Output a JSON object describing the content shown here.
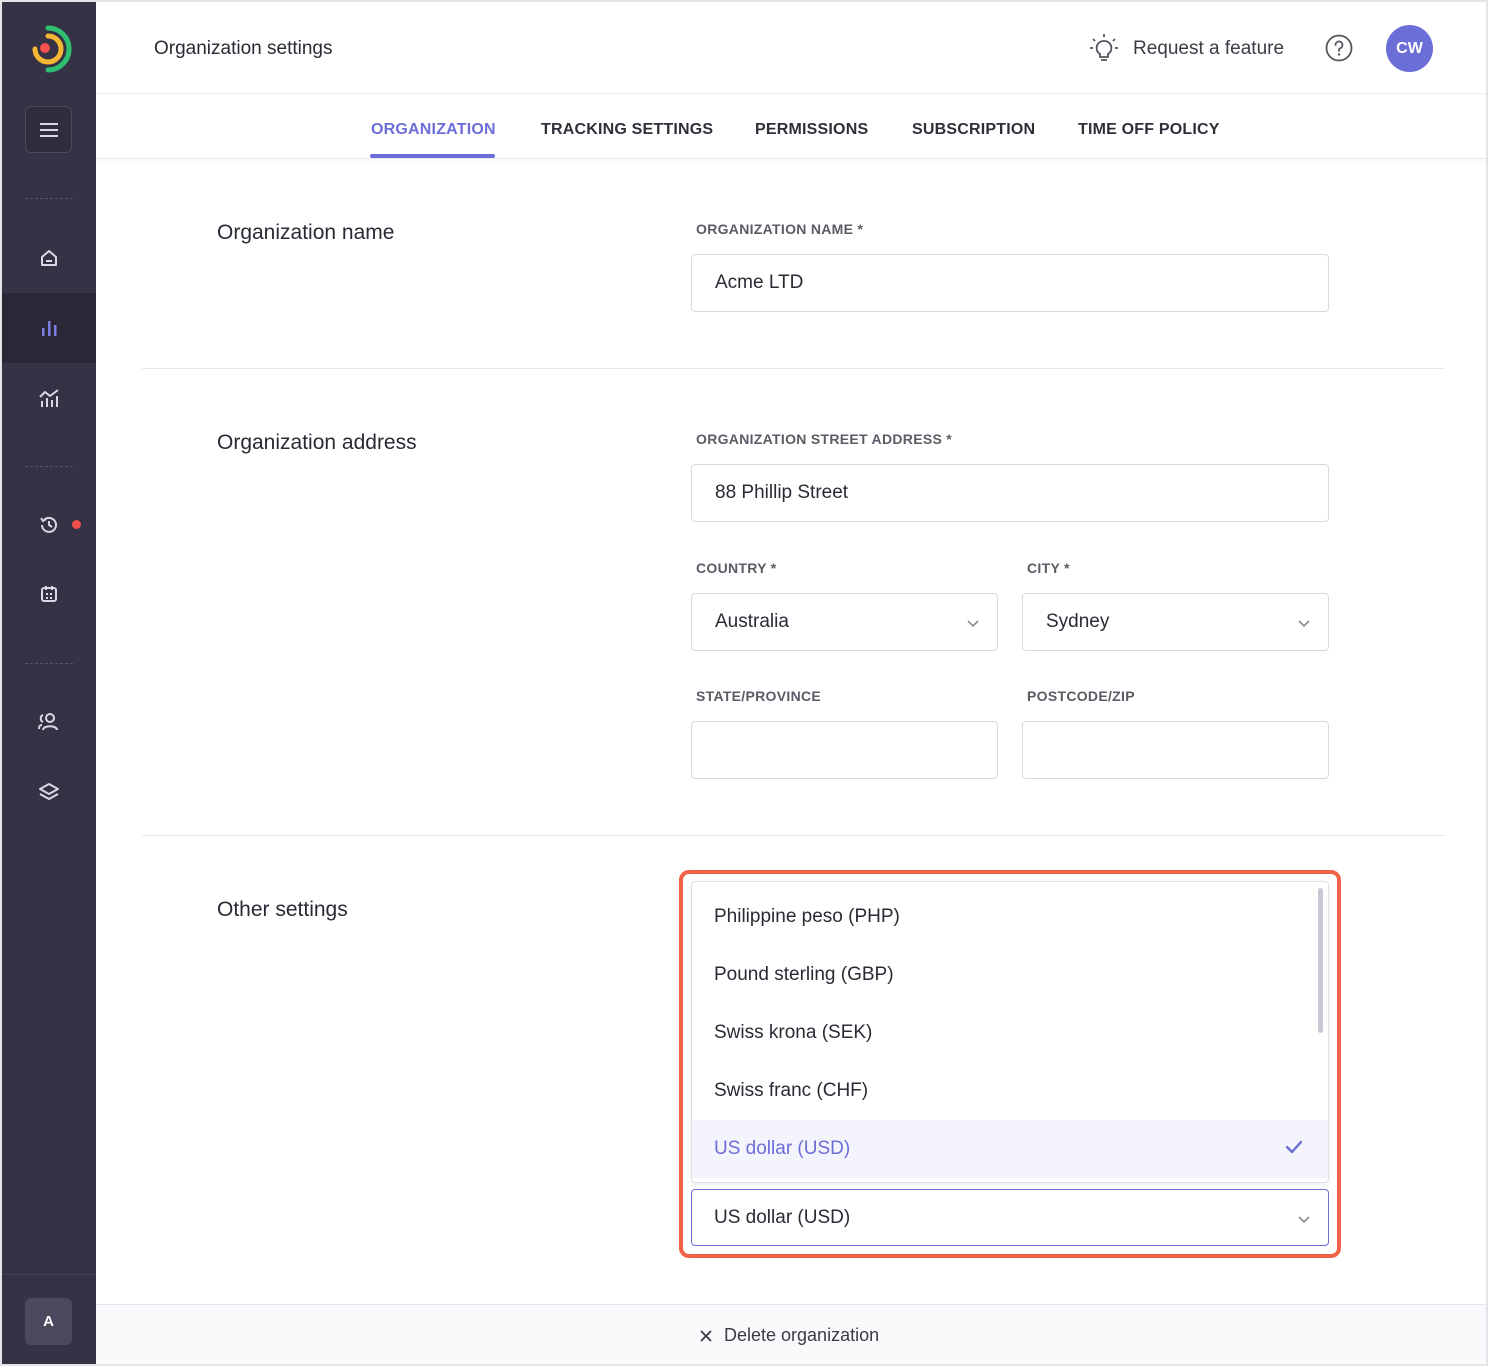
{
  "header": {
    "title": "Organization settings",
    "request_feature": "Request a feature",
    "avatar_initials": "CW"
  },
  "tabs": [
    {
      "label": "ORGANIZATION",
      "active": true
    },
    {
      "label": "TRACKING SETTINGS"
    },
    {
      "label": "PERMISSIONS"
    },
    {
      "label": "SUBSCRIPTION"
    },
    {
      "label": "TIME OFF POLICY"
    }
  ],
  "sidebar": {
    "items": [
      "menu-icon",
      "home-icon",
      "bar-chart-icon",
      "trend-chart-icon",
      "history-icon",
      "calendar-icon",
      "users-icon",
      "layers-icon"
    ],
    "active_item": "bar-chart-icon",
    "account_initial": "A",
    "notification_color": "#f2504b"
  },
  "sections": {
    "org_name": {
      "title": "Organization name",
      "label": "ORGANIZATION NAME *",
      "value": "Acme LTD"
    },
    "org_address": {
      "title": "Organization address",
      "street_label": "ORGANIZATION STREET ADDRESS *",
      "street_value": "88 Phillip Street",
      "country_label": "COUNTRY *",
      "country_value": "Australia",
      "city_label": "CITY *",
      "city_value": "Sydney",
      "state_label": "STATE/PROVINCE",
      "state_value": "",
      "postcode_label": "POSTCODE/ZIP",
      "postcode_value": ""
    },
    "other": {
      "title": "Other settings",
      "currency_options": [
        "Philippine peso (PHP)",
        "Pound sterling (GBP)",
        "Swiss krona (SEK)",
        "Swiss franc (CHF)",
        "US dollar (USD)"
      ],
      "currency_selected": "US dollar (USD)"
    }
  },
  "footer": {
    "delete_label": "Delete organization"
  },
  "colors": {
    "accent": "#6c6ed8",
    "sidebar": "#343244",
    "highlight": "#f06348"
  }
}
